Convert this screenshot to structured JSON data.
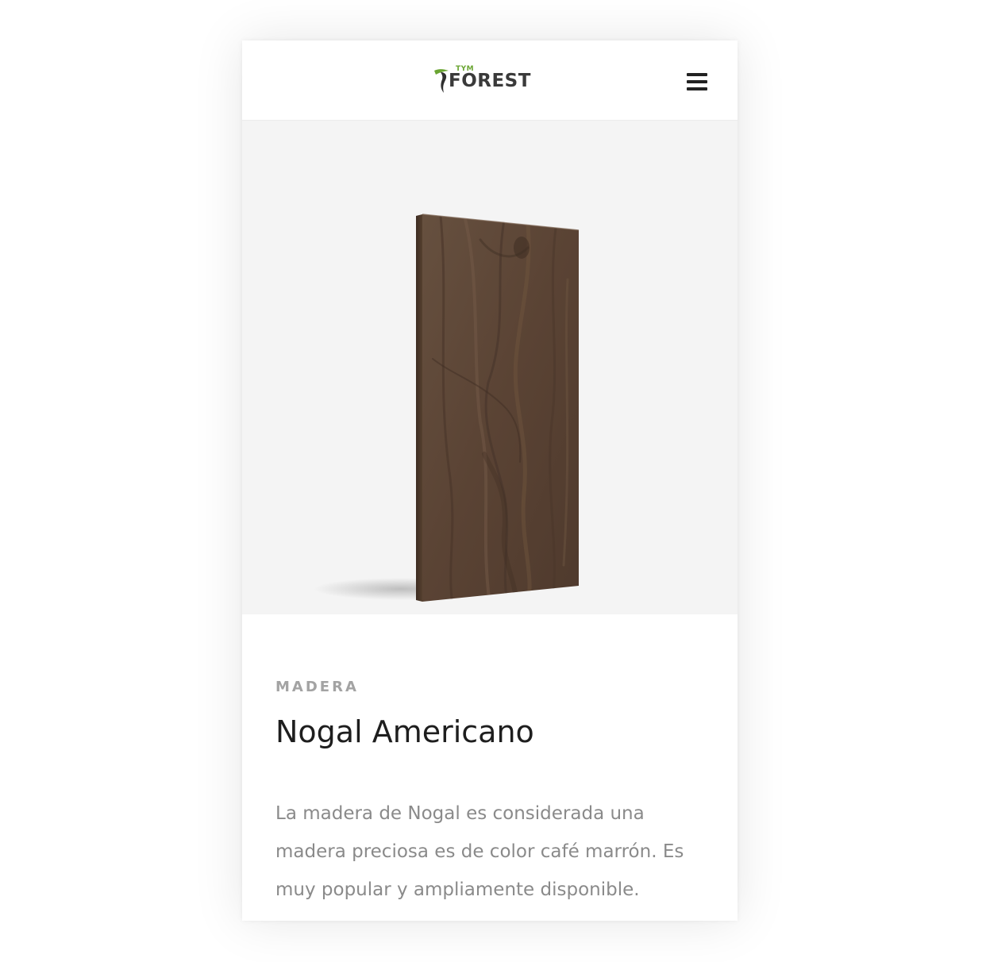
{
  "header": {
    "logo_small": "TYM",
    "logo_word": "FOREST",
    "menu_icon": "hamburger-menu-icon"
  },
  "hero": {
    "image": "walnut-wood-plank",
    "background_color": "#f4f4f4",
    "wood_color": "#5e4739"
  },
  "product": {
    "category": "MADERA",
    "title": "Nogal Americano",
    "description": "La madera de Nogal es considerada una madera preciosa es de color café marrón. Es muy popular y ampliamente disponible."
  },
  "colors": {
    "logo_green": "#6aa532",
    "logo_dark": "#3a3a3a",
    "text_muted": "#8a8a8a",
    "text_dark": "#1e1e1e"
  }
}
